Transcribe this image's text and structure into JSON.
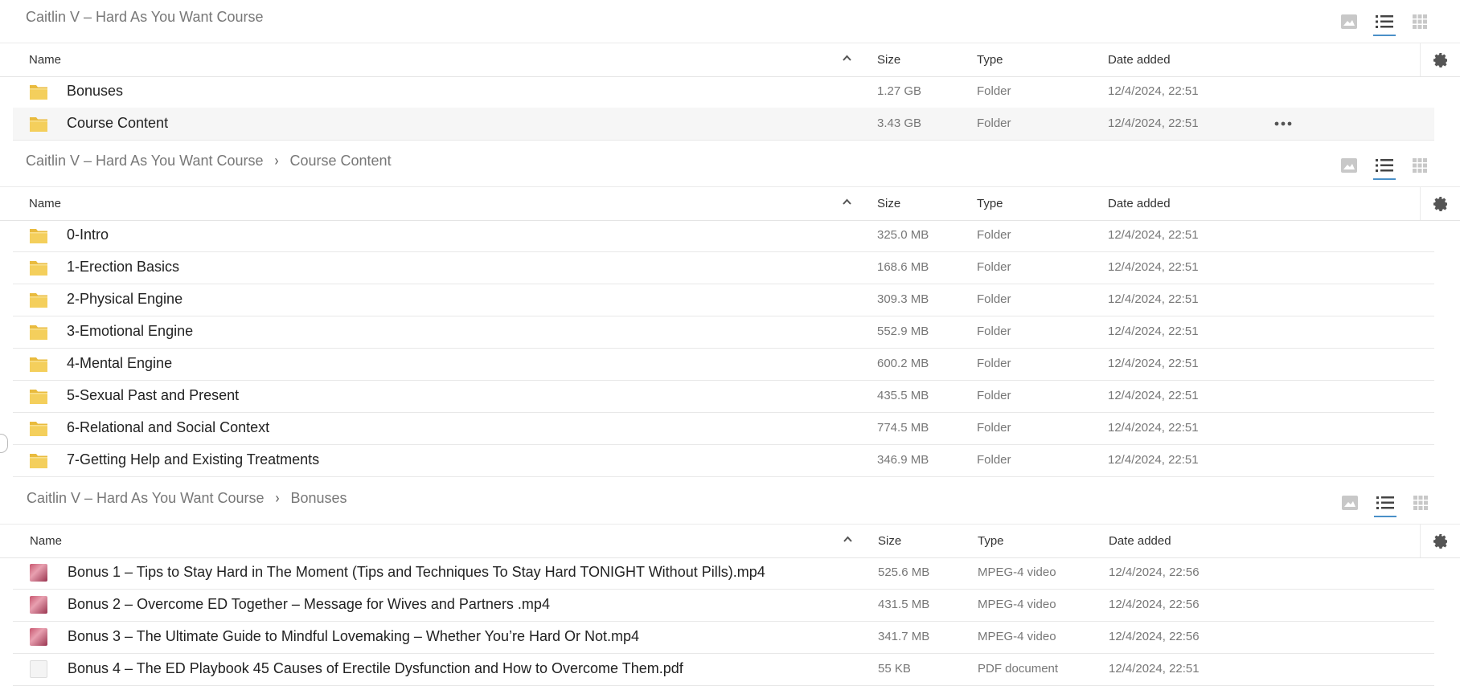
{
  "columns": {
    "name": "Name",
    "size": "Size",
    "type": "Type",
    "date": "Date added"
  },
  "icons": {
    "folder": "folder-icon",
    "video": "video-thumbnail-icon",
    "pdf": "pdf-thumbnail-icon",
    "gallery": "image-view-icon",
    "list": "list-view-icon",
    "grid": "grid-view-icon",
    "settings": "gear-icon",
    "sort": "sort-ascending-icon",
    "more": "more-options-icon"
  },
  "colors": {
    "accent": "#4a90c8",
    "folder": "#f4cf5c"
  },
  "panel1": {
    "crumbs": [
      "Caitlin V – Hard As You Want Course"
    ],
    "rows": [
      {
        "name": "Bonuses",
        "size": "1.27 GB",
        "type": "Folder",
        "date": "12/4/2024, 22:51"
      },
      {
        "name": "Course Content",
        "size": "3.43 GB",
        "type": "Folder",
        "date": "12/4/2024, 22:51"
      }
    ]
  },
  "panel2": {
    "crumbs": [
      "Caitlin V – Hard As You Want Course",
      "Course Content"
    ],
    "rows": [
      {
        "name": "0-Intro",
        "size": "325.0 MB",
        "type": "Folder",
        "date": "12/4/2024, 22:51"
      },
      {
        "name": "1-Erection Basics",
        "size": "168.6 MB",
        "type": "Folder",
        "date": "12/4/2024, 22:51"
      },
      {
        "name": "2-Physical Engine",
        "size": "309.3 MB",
        "type": "Folder",
        "date": "12/4/2024, 22:51"
      },
      {
        "name": "3-Emotional Engine",
        "size": "552.9 MB",
        "type": "Folder",
        "date": "12/4/2024, 22:51"
      },
      {
        "name": "4-Mental Engine",
        "size": "600.2 MB",
        "type": "Folder",
        "date": "12/4/2024, 22:51"
      },
      {
        "name": "5-Sexual Past and Present",
        "size": "435.5 MB",
        "type": "Folder",
        "date": "12/4/2024, 22:51"
      },
      {
        "name": "6-Relational and Social Context",
        "size": "774.5 MB",
        "type": "Folder",
        "date": "12/4/2024, 22:51"
      },
      {
        "name": "7-Getting Help and Existing Treatments",
        "size": "346.9 MB",
        "type": "Folder",
        "date": "12/4/2024, 22:51"
      }
    ]
  },
  "panel3": {
    "crumbs": [
      "Caitlin V – Hard As You Want Course",
      "Bonuses"
    ],
    "rows": [
      {
        "name": "Bonus 1 – Tips to Stay Hard in The Moment (Tips and Techniques To Stay Hard TONIGHT Without Pills).mp4",
        "size": "525.6 MB",
        "type": "MPEG-4 video",
        "date": "12/4/2024, 22:56"
      },
      {
        "name": "Bonus 2 – Overcome ED Together – Message for Wives and Partners .mp4",
        "size": "431.5 MB",
        "type": "MPEG-4 video",
        "date": "12/4/2024, 22:56"
      },
      {
        "name": "Bonus 3 – The Ultimate Guide to Mindful Lovemaking – Whether You’re Hard Or Not.mp4",
        "size": "341.7 MB",
        "type": "MPEG-4 video",
        "date": "12/4/2024, 22:56"
      },
      {
        "name": "Bonus 4 – The ED Playbook 45 Causes of Erectile Dysfunction and How to Overcome Them.pdf",
        "size": "55 KB",
        "type": "PDF document",
        "date": "12/4/2024, 22:51"
      }
    ]
  }
}
